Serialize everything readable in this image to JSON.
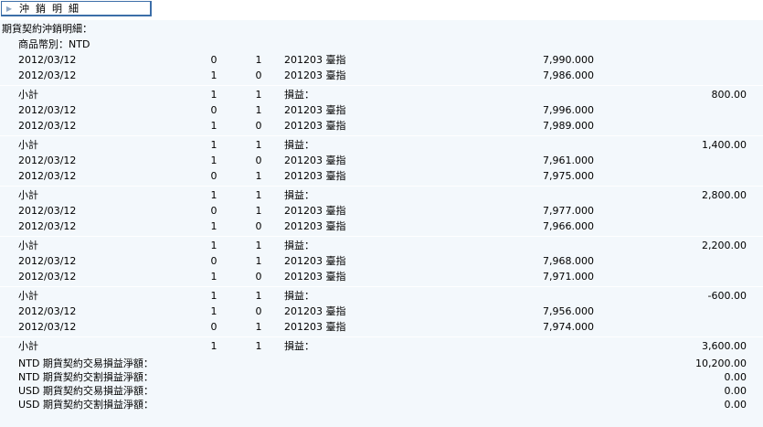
{
  "tab": {
    "label": "沖銷明細"
  },
  "section_title": "期貨契約沖銷明細：",
  "currency_line": "商品幣別：NTD",
  "groups": [
    {
      "rows": [
        {
          "date": "2012/03/12",
          "a": "0",
          "b": "1",
          "product": "201203 臺指",
          "price": "7,990.000"
        },
        {
          "date": "2012/03/12",
          "a": "1",
          "b": "0",
          "product": "201203 臺指",
          "price": "7,986.000"
        }
      ],
      "subtotal": {
        "label": "小計",
        "a": "1",
        "b": "1",
        "pl_label": "損益：",
        "amount": "800.00"
      }
    },
    {
      "rows": [
        {
          "date": "2012/03/12",
          "a": "0",
          "b": "1",
          "product": "201203 臺指",
          "price": "7,996.000"
        },
        {
          "date": "2012/03/12",
          "a": "1",
          "b": "0",
          "product": "201203 臺指",
          "price": "7,989.000"
        }
      ],
      "subtotal": {
        "label": "小計",
        "a": "1",
        "b": "1",
        "pl_label": "損益：",
        "amount": "1,400.00"
      }
    },
    {
      "rows": [
        {
          "date": "2012/03/12",
          "a": "1",
          "b": "0",
          "product": "201203 臺指",
          "price": "7,961.000"
        },
        {
          "date": "2012/03/12",
          "a": "0",
          "b": "1",
          "product": "201203 臺指",
          "price": "7,975.000"
        }
      ],
      "subtotal": {
        "label": "小計",
        "a": "1",
        "b": "1",
        "pl_label": "損益：",
        "amount": "2,800.00"
      }
    },
    {
      "rows": [
        {
          "date": "2012/03/12",
          "a": "0",
          "b": "1",
          "product": "201203 臺指",
          "price": "7,977.000"
        },
        {
          "date": "2012/03/12",
          "a": "1",
          "b": "0",
          "product": "201203 臺指",
          "price": "7,966.000"
        }
      ],
      "subtotal": {
        "label": "小計",
        "a": "1",
        "b": "1",
        "pl_label": "損益：",
        "amount": "2,200.00"
      }
    },
    {
      "rows": [
        {
          "date": "2012/03/12",
          "a": "0",
          "b": "1",
          "product": "201203 臺指",
          "price": "7,968.000"
        },
        {
          "date": "2012/03/12",
          "a": "1",
          "b": "0",
          "product": "201203 臺指",
          "price": "7,971.000"
        }
      ],
      "subtotal": {
        "label": "小計",
        "a": "1",
        "b": "1",
        "pl_label": "損益：",
        "amount": "-600.00"
      }
    },
    {
      "rows": [
        {
          "date": "2012/03/12",
          "a": "1",
          "b": "0",
          "product": "201203 臺指",
          "price": "7,956.000"
        },
        {
          "date": "2012/03/12",
          "a": "0",
          "b": "1",
          "product": "201203 臺指",
          "price": "7,974.000"
        }
      ],
      "subtotal": {
        "label": "小計",
        "a": "1",
        "b": "1",
        "pl_label": "損益：",
        "amount": "3,600.00"
      }
    }
  ],
  "totals": [
    {
      "label": "NTD 期貨契約交易損益淨額：",
      "amount": "10,200.00"
    },
    {
      "label": "NTD 期貨契約交割損益淨額：",
      "amount": "0.00"
    },
    {
      "label": "USD 期貨契約交易損益淨額：",
      "amount": "0.00"
    },
    {
      "label": "USD 期貨契約交割損益淨額：",
      "amount": "0.00"
    }
  ]
}
